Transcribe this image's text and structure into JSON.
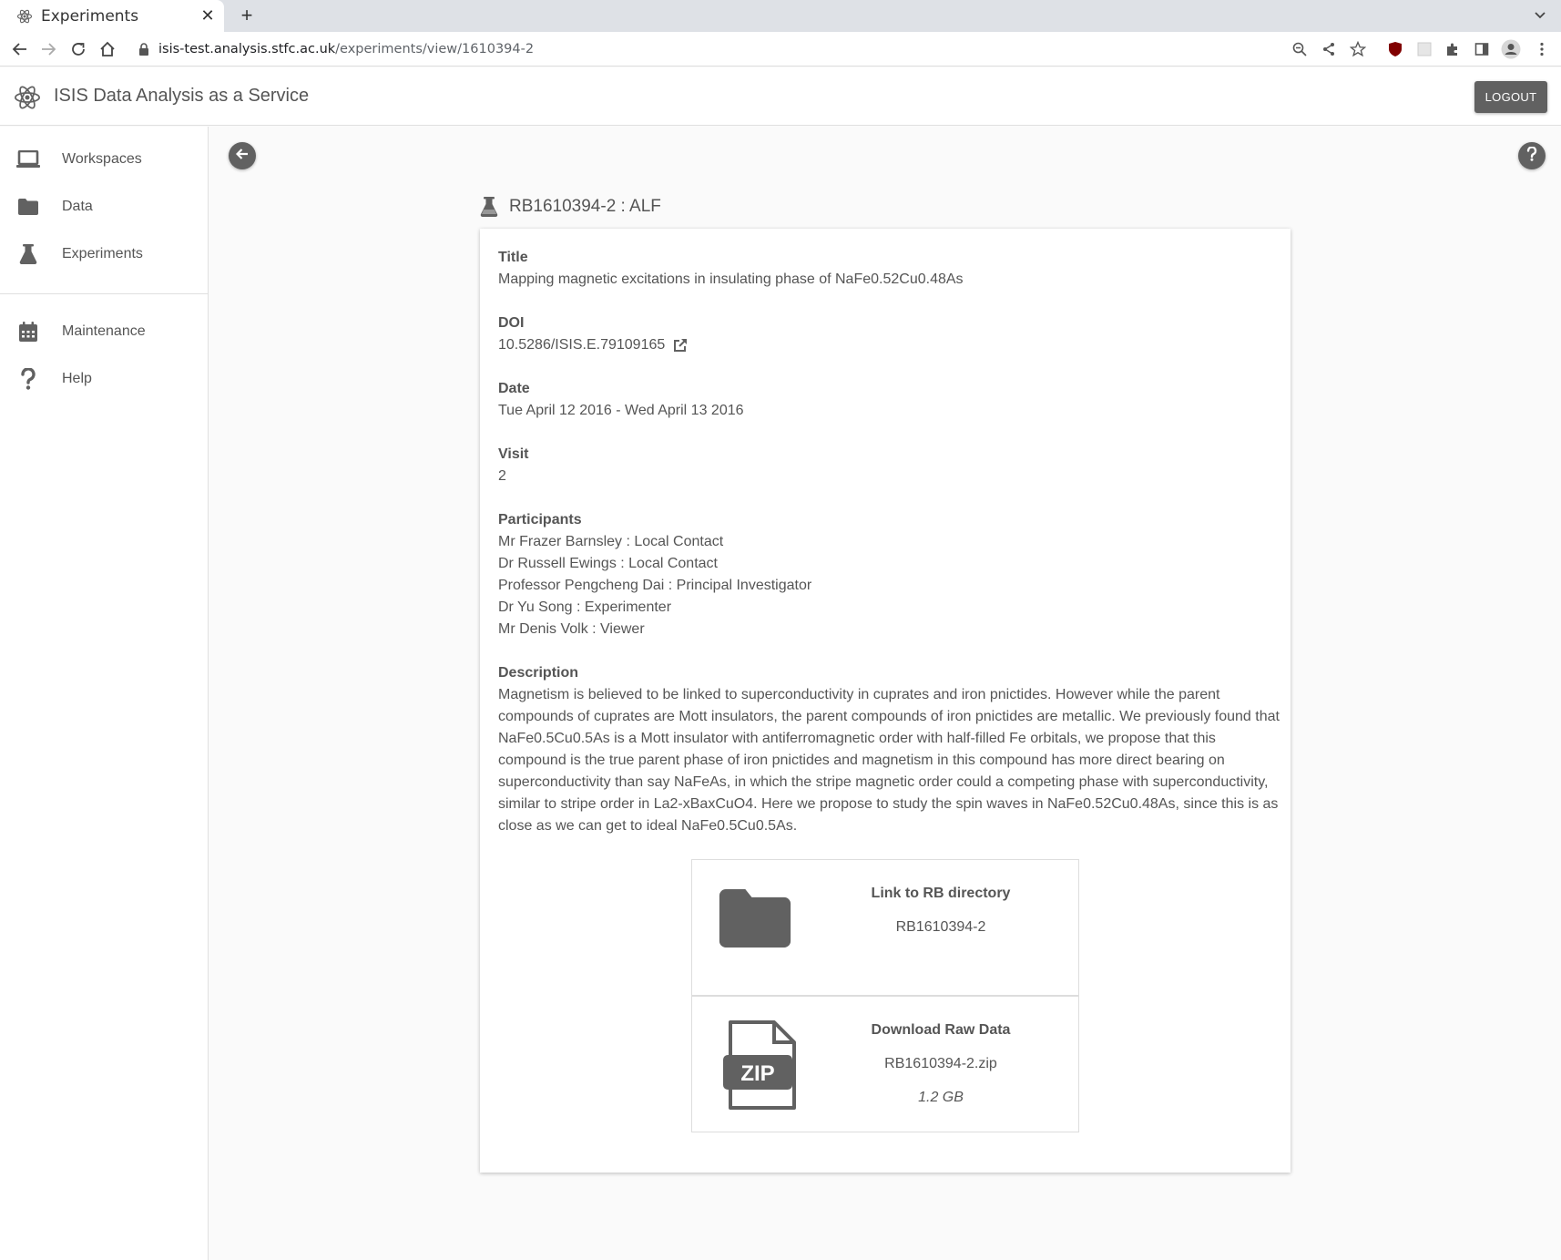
{
  "browser": {
    "tab_title": "Experiments",
    "url_host": "isis-test.analysis.stfc.ac.uk",
    "url_path": "/experiments/view/1610394-2"
  },
  "app": {
    "title": "ISIS Data Analysis as a Service",
    "logout_label": "LOGOUT"
  },
  "sidebar": {
    "items": [
      {
        "label": "Workspaces",
        "icon": "laptop-icon"
      },
      {
        "label": "Data",
        "icon": "folder-icon"
      },
      {
        "label": "Experiments",
        "icon": "flask-icon"
      },
      {
        "label": "Maintenance",
        "icon": "calendar-icon"
      },
      {
        "label": "Help",
        "icon": "question-icon"
      }
    ]
  },
  "experiment": {
    "heading": "RB1610394-2 : ALF",
    "title_label": "Title",
    "title": "Mapping magnetic excitations in insulating phase of NaFe0.52Cu0.48As",
    "doi_label": "DOI",
    "doi": "10.5286/ISIS.E.79109165",
    "date_label": "Date",
    "date": "Tue April 12 2016 - Wed April 13 2016",
    "visit_label": "Visit",
    "visit": "2",
    "participants_label": "Participants",
    "participants": [
      "Mr Frazer Barnsley : Local Contact",
      "Dr Russell Ewings : Local Contact",
      "Professor Pengcheng Dai : Principal Investigator",
      "Dr Yu Song : Experimenter",
      "Mr Denis Volk : Viewer"
    ],
    "description_label": "Description",
    "description": "Magnetism is believed to be linked to superconductivity in cuprates and iron pnictides. However while the parent compounds of cuprates are Mott insulators, the parent compounds of iron pnictides are metallic. We previously found that NaFe0.5Cu0.5As is a Mott insulator with antiferromagnetic order with half-filled Fe orbitals, we propose that this compound is the true parent phase of iron pnictides and magnetism in this compound has more direct bearing on superconductivity than say NaFeAs, in which the stripe magnetic order could a competing phase with superconductivity, similar to stripe order in La2-xBaxCuO4. Here we propose to study the spin waves in NaFe0.52Cu0.48As, since this is as close as we can get to ideal NaFe0.5Cu0.5As."
  },
  "links": {
    "rb_title": "Link to RB directory",
    "rb_value": "RB1610394-2",
    "download_title": "Download Raw Data",
    "download_file": "RB1610394-2.zip",
    "download_size": "1.2 GB",
    "zip_label": "ZIP"
  },
  "colors": {
    "icon_gray": "#616161",
    "text_gray": "#555555"
  }
}
